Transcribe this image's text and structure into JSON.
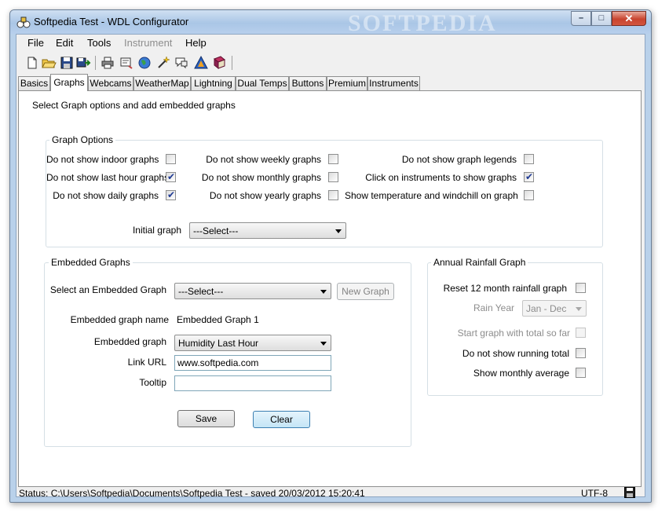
{
  "window": {
    "title": "Softpedia Test - WDL Configurator",
    "watermark": "SOFTPEDIA",
    "controls": {
      "minimize": "–",
      "maximize": "□",
      "close": "✕"
    }
  },
  "menu": {
    "items": [
      {
        "label": "File"
      },
      {
        "label": "Edit"
      },
      {
        "label": "Tools"
      },
      {
        "label": "Instrument",
        "disabled": true
      },
      {
        "label": "Help"
      }
    ]
  },
  "toolbar": {
    "icons": [
      "new-file-icon",
      "open-folder-icon",
      "save-icon",
      "save-as-icon",
      "print-icon",
      "preview-icon",
      "globe-icon",
      "settings-wand-icon",
      "chat-icon",
      "triangle-tool-icon",
      "book-icon"
    ]
  },
  "tabs": [
    {
      "label": "Basics"
    },
    {
      "label": "Graphs",
      "active": true
    },
    {
      "label": "Webcams"
    },
    {
      "label": "WeatherMap"
    },
    {
      "label": "Lightning"
    },
    {
      "label": "Dual Temps"
    },
    {
      "label": "Buttons"
    },
    {
      "label": "Premium"
    },
    {
      "label": "Instruments"
    }
  ],
  "page": {
    "subtitle": "Select Graph options and add embedded graphs"
  },
  "graph_options": {
    "legend": "Graph Options",
    "checkboxes": [
      {
        "label": "Do not show indoor graphs",
        "checked": false
      },
      {
        "label": "Do not show last hour graphs",
        "checked": true
      },
      {
        "label": "Do not show daily graphs",
        "checked": true
      },
      {
        "label": "Do not show weekly graphs",
        "checked": false
      },
      {
        "label": "Do not show monthly graphs",
        "checked": false
      },
      {
        "label": "Do not show yearly graphs",
        "checked": false
      },
      {
        "label": "Do not show graph legends",
        "checked": false
      },
      {
        "label": "Click on instruments to show graphs",
        "checked": true
      },
      {
        "label": "Show temperature and windchill on graph",
        "checked": false
      }
    ],
    "initial_graph_label": "Initial graph",
    "initial_graph_value": "---Select---"
  },
  "embedded_graphs": {
    "legend": "Embedded Graphs",
    "select_label": "Select an Embedded Graph",
    "select_value": "---Select---",
    "new_graph_button": "New Graph",
    "name_label": "Embedded graph name",
    "name_value": "Embedded Graph 1",
    "graph_label": "Embedded graph",
    "graph_value": "Humidity Last Hour",
    "link_label": "Link URL",
    "link_value": "www.softpedia.com",
    "tooltip_label": "Tooltip",
    "tooltip_value": "",
    "save_button": "Save",
    "clear_button": "Clear"
  },
  "annual_rainfall": {
    "legend": "Annual Rainfall Graph",
    "reset_label": "Reset 12 month rainfall graph",
    "reset_checked": false,
    "rain_year_label": "Rain Year",
    "rain_year_value": "Jan - Dec",
    "start_total_label": "Start graph with total so far",
    "start_total_checked": false,
    "running_total_label": "Do not show running total",
    "running_total_checked": false,
    "monthly_avg_label": "Show monthly average",
    "monthly_avg_checked": false
  },
  "status": {
    "text": "Status: C:\\Users\\Softpedia\\Documents\\Softpedia Test - saved 20/03/2012 15:20:41",
    "encoding": "UTF-8"
  }
}
